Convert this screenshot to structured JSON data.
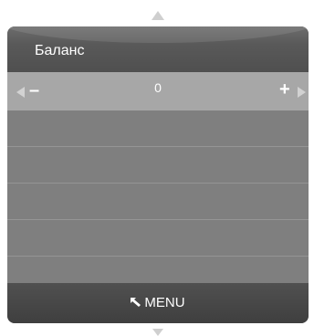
{
  "header": {
    "title": "Баланс"
  },
  "slider": {
    "decrease_label": "–",
    "increase_label": "+",
    "value": "0"
  },
  "empty_rows": [
    "",
    "",
    "",
    "",
    ""
  ],
  "footer": {
    "menu_label": "MENU"
  },
  "icons": {
    "scroll_up": "triangle-up-icon",
    "scroll_down": "triangle-down-icon",
    "left": "triangle-left-icon",
    "right": "triangle-right-icon",
    "back": "return-arrow-icon"
  },
  "colors": {
    "header": "#555555",
    "selected_row": "#a7a7a7",
    "row": "#7f7f7f",
    "footer": "#474747",
    "text": "#ffffff"
  }
}
